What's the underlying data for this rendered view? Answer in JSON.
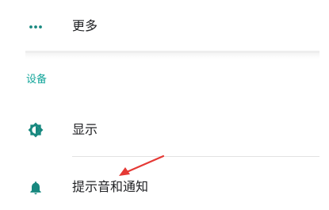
{
  "colors": {
    "accent": "#12a59a",
    "icon": "#17887f",
    "text": "#202124",
    "annotation_arrow": "#e53935"
  },
  "more": {
    "label": "更多",
    "icon": "more-horizontal-icon"
  },
  "section": {
    "header": "设备"
  },
  "items": [
    {
      "label": "显示",
      "icon": "brightness-icon"
    },
    {
      "label": "提示音和通知",
      "icon": "bell-icon"
    }
  ]
}
